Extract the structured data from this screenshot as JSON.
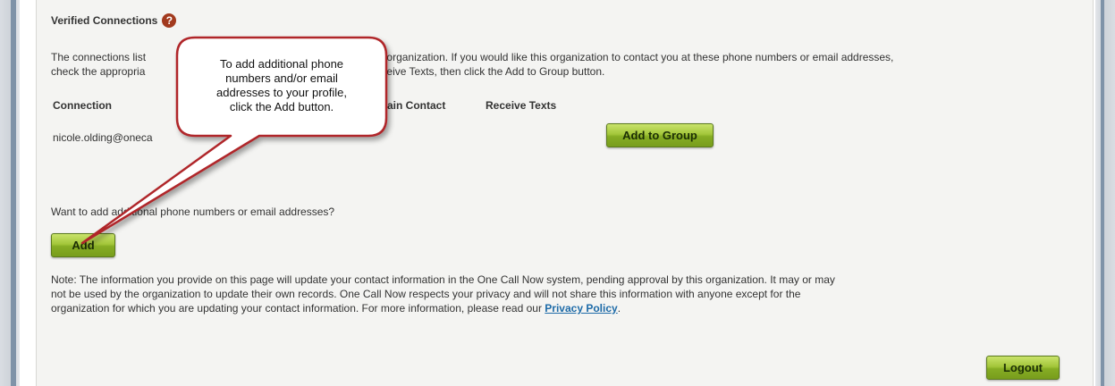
{
  "section": {
    "title": "Verified Connections",
    "help_glyph": "?"
  },
  "intro": {
    "line1": "The connections list",
    "line1_right": "HIS organization. If you would like this organization to contact you at these phone numbers or email addresses,",
    "line2": "check the appropria",
    "line2_right": "eive Texts, then click the Add to Group button."
  },
  "table": {
    "headers": {
      "connection": "Connection",
      "main_contact": "ain Contact",
      "receive_texts": "Receive Texts"
    },
    "row_email": "nicole.olding@oneca"
  },
  "buttons": {
    "add_to_group": "Add to Group",
    "add": "Add",
    "logout": "Logout"
  },
  "want_text": "Want to add additional phone numbers or email addresses?",
  "note": {
    "line1": "Note: The information you provide on this page will update your contact information in the One Call Now system, pending approval by this organization. It may or may",
    "line2": "not be used by the organization to update their own records. One Call Now respects your privacy and will not share this information with anyone except for the",
    "line3": "organization for which you are updating your contact information. For more information, please read our ",
    "link": "Privacy Policy",
    "line3_end": "."
  },
  "callout": {
    "line1": "To add additional phone",
    "line2": "numbers and/or email",
    "line3": "addresses to your profile,",
    "line4": "click the Add button."
  },
  "colors": {
    "button_green": "#a3c63a",
    "callout_border": "#b0282a",
    "link": "#1e6ba8",
    "help_icon": "#a23a1e"
  }
}
